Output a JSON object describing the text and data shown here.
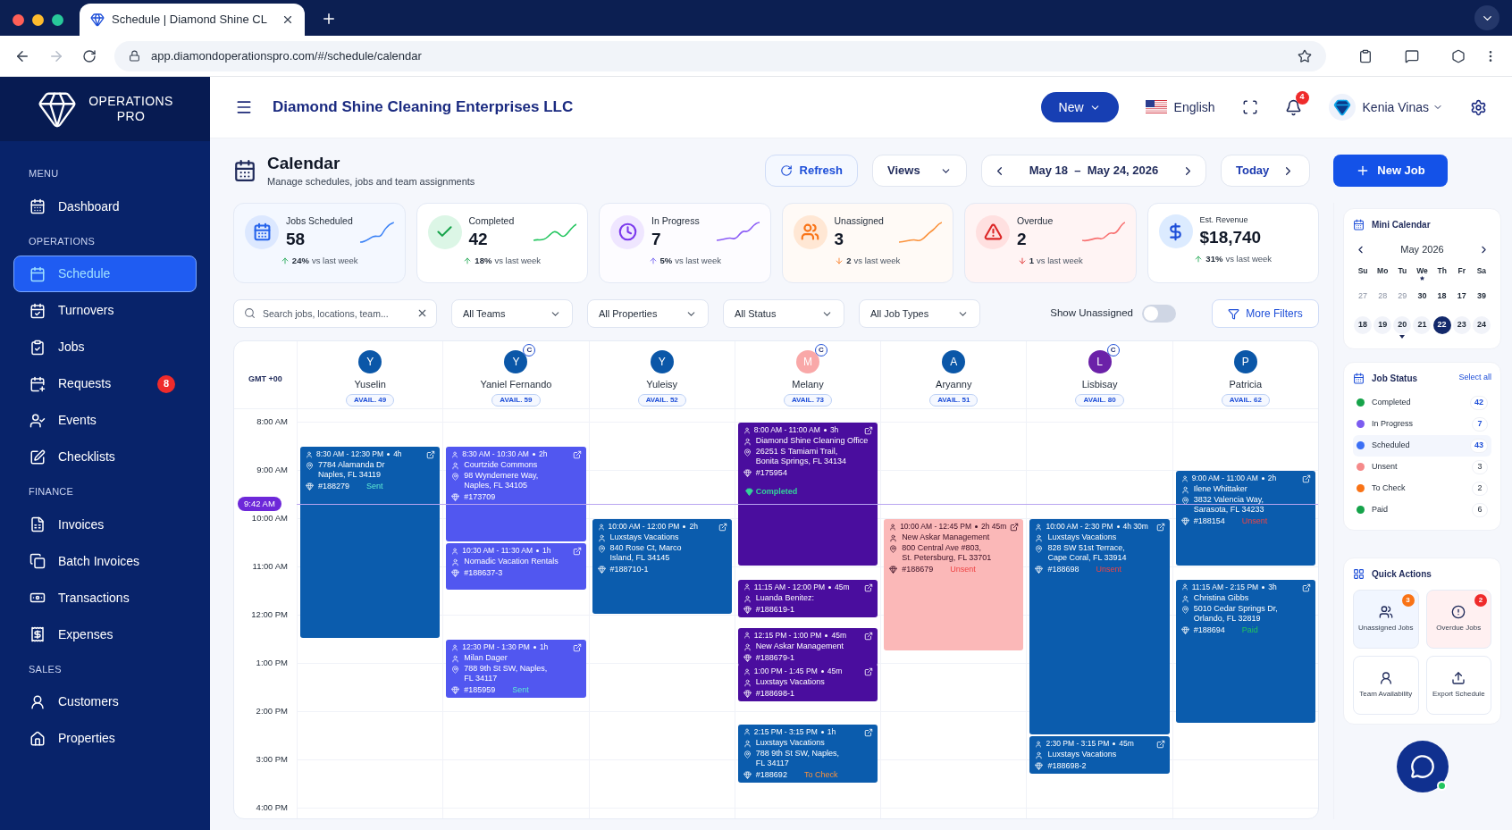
{
  "browser": {
    "tab_title": "Schedule | Diamond Shine CL",
    "url": "app.diamondoperationspro.com/#/schedule/calendar"
  },
  "sidebar": {
    "brand_top": "OPERATIONS",
    "brand_bottom": "PRO",
    "sections": [
      {
        "title": "MENU",
        "items": [
          {
            "label": "Dashboard",
            "selected": false
          }
        ]
      },
      {
        "title": "OPERATIONS",
        "items": [
          {
            "label": "Schedule",
            "selected": true
          },
          {
            "label": "Turnovers",
            "selected": false
          },
          {
            "label": "Jobs",
            "selected": false
          },
          {
            "label": "Requests",
            "selected": false,
            "badge": "8"
          },
          {
            "label": "Events",
            "selected": false
          },
          {
            "label": "Checklists",
            "selected": false
          }
        ]
      },
      {
        "title": "FINANCE",
        "items": [
          {
            "label": "Invoices",
            "selected": false
          },
          {
            "label": "Batch Invoices",
            "selected": false
          },
          {
            "label": "Transactions",
            "selected": false
          },
          {
            "label": "Expenses",
            "selected": false
          }
        ]
      },
      {
        "title": "SALES",
        "items": [
          {
            "label": "Customers",
            "selected": false
          },
          {
            "label": "Properties",
            "selected": false
          }
        ]
      }
    ]
  },
  "header": {
    "company": "Diamond Shine Cleaning Enterprises LLC",
    "new_button": "New",
    "language": "English",
    "notifications": "4",
    "user": "Kenia Vinas"
  },
  "page": {
    "title": "Calendar",
    "subtitle": "Manage schedules, jobs and team assignments",
    "refresh": "Refresh",
    "views": "Views",
    "date_range": "May 18  –  May 24, 2026",
    "today": "Today",
    "new_job": "New Job"
  },
  "stats": [
    {
      "kind": "scheduled",
      "label": "Jobs Scheduled",
      "value": "58",
      "rising": true,
      "change": "24%",
      "note": "vs last week"
    },
    {
      "kind": "completed",
      "label": "Completed",
      "value": "42",
      "rising": true,
      "change": "18%",
      "note": "vs last week"
    },
    {
      "kind": "progress",
      "label": "In Progress",
      "value": "7",
      "rising": true,
      "change": "5%",
      "note": "vs last week"
    },
    {
      "kind": "unassigned",
      "label": "Unassigned",
      "value": "3",
      "rising": false,
      "change": "2",
      "note": "vs last week"
    },
    {
      "kind": "overdue",
      "label": "Overdue",
      "value": "2",
      "rising": false,
      "change": "1",
      "note": "vs last week"
    },
    {
      "kind": "revenue",
      "label": "Est. Revenue",
      "value": "$18,740",
      "rising": true,
      "change": "31%",
      "note": "vs last week"
    }
  ],
  "filters": {
    "search_placeholder": "Search jobs, locations, team...",
    "dropdowns": [
      "All Teams",
      "All Properties",
      "All Status",
      "All Job Types"
    ],
    "show_unassigned": {
      "label": "Show Unassigned",
      "on": false
    },
    "more_filters": "More Filters"
  },
  "calendar": {
    "timezone": "GMT +00",
    "now": "9:42 AM",
    "hours": [
      "8:00 AM",
      "9:00 AM",
      "10:00 AM",
      "11:00 AM",
      "12:00 PM",
      "1:00 PM",
      "2:00 PM",
      "3:00 PM",
      "4:00 PM"
    ],
    "staff": [
      {
        "initial": "Y",
        "name": "Yuselin",
        "avail": "AVAIL. 49",
        "color": "#0b57a8",
        "events": [
          {
            "time": "8:30 AM - 12:30 PM",
            "duration": "4h",
            "address": [
              "7784 Alamanda Dr",
              "Naples, FL 34119"
            ],
            "job": "#188279",
            "status": {
              "text": "Sent",
              "kind": "sent"
            },
            "color": "#0b5cad"
          }
        ]
      },
      {
        "initial": "Y",
        "name": "Yaniel Fernando",
        "avail": "AVAIL. 59",
        "color": "#0b57a8",
        "badge": "C",
        "events": [
          {
            "time": "8:30 AM - 10:30 AM",
            "duration": "2h",
            "client": "Courtzide Commons",
            "address": [
              "98 Wyndemere Way,",
              "Naples, FL 34105"
            ],
            "job": "#173709",
            "color": "#5157f0"
          },
          {
            "time": "10:30 AM - 11:30 AM",
            "duration": "1h",
            "client": "Nomadic Vacation Rentals",
            "job": "#188637-3",
            "color": "#5157f0"
          },
          {
            "time": "12:30 PM - 1:30 PM",
            "duration": "1h",
            "client": "Milan Dager",
            "address": [
              "788 9th St SW, Naples,",
              "FL 34117"
            ],
            "job": "#185959",
            "status": {
              "text": "Sent",
              "kind": "sent"
            },
            "color": "#5157f0"
          }
        ]
      },
      {
        "initial": "Y",
        "name": "Yuleisy",
        "avail": "AVAIL. 52",
        "color": "#0b57a8",
        "events": [
          {
            "time": "10:00 AM - 12:00 PM",
            "duration": "2h",
            "client": "Luxstays Vacations",
            "address": [
              "840 Rose Ct, Marco",
              "Island, FL 34145"
            ],
            "job": "#188710-1",
            "color": "#0b5cad"
          }
        ]
      },
      {
        "initial": "M",
        "name": "Melany",
        "avail": "AVAIL. 73",
        "color": "#f9a8a8",
        "badge": "C",
        "events": [
          {
            "time": "8:00 AM - 11:00 AM",
            "duration": "3h",
            "client": "Diamond Shine Cleaning Office",
            "address": [
              "26251 S Tamiami Trail,",
              "Bonita Springs, FL 34134"
            ],
            "job": "#175954",
            "status": {
              "text": "Completed",
              "kind": "completed"
            },
            "color": "#4a0d9e"
          },
          {
            "time": "11:15 AM - 12:00 PM",
            "duration": "45m",
            "client": "Luanda Benitez:",
            "job": "#188619-1",
            "color": "#4a0d9e"
          },
          {
            "time": "12:15 PM - 1:00 PM",
            "duration": "45m",
            "client": "New Askar Management",
            "job": "#188679-1",
            "color": "#4a0d9e"
          },
          {
            "time": "1:00 PM - 1:45 PM",
            "duration": "45m",
            "client": "Luxstays Vacations",
            "job": "#188698-1",
            "color": "#4a0d9e"
          },
          {
            "time": "2:15 PM - 3:15 PM",
            "duration": "1h",
            "client": "Luxstays Vacations",
            "address": [
              "788 9th St SW, Naples,",
              "FL 34117"
            ],
            "job": "#188692",
            "status": {
              "text": "To Check",
              "kind": "to_check"
            },
            "color": "#0b5cad"
          }
        ]
      },
      {
        "initial": "A",
        "name": "Aryanny",
        "avail": "AVAIL. 51",
        "color": "#0b57a8",
        "events": [
          {
            "time": "10:00 AM - 12:45 PM",
            "duration": "2h 45m",
            "client": "New Askar Management",
            "address": [
              "800 Central Ave #803,",
              "St. Petersburg, FL 33701"
            ],
            "job": "#188679",
            "status": {
              "text": "Unsent",
              "kind": "unsent"
            },
            "color": "#fbb8b8"
          }
        ]
      },
      {
        "initial": "L",
        "name": "Lisbisay",
        "avail": "AVAIL. 80",
        "color": "#6b21a8",
        "badge": "C",
        "events": [
          {
            "time": "10:00 AM - 2:30 PM",
            "duration": "4h 30m",
            "client": "Luxstays Vacations",
            "address": [
              "828 SW 51st Terrace,",
              "Cape Coral, FL 33914"
            ],
            "job": "#188698",
            "status": {
              "text": "Unsent",
              "kind": "unsent"
            },
            "color": "#0b5cad"
          },
          {
            "time": "2:30 PM - 3:15 PM",
            "duration": "45m",
            "client": "Luxstays Vacations",
            "job": "#188698-2",
            "color": "#0b5cad"
          }
        ]
      },
      {
        "initial": "P",
        "name": "Patricia",
        "avail": "AVAIL. 62",
        "color": "#0b57a8",
        "events": [
          {
            "time": "9:00 AM - 11:00 AM",
            "duration": "2h",
            "client": "Ilene Whittaker",
            "address": [
              "3832 Valencia Way,",
              "Sarasota, FL 34233"
            ],
            "job": "#188154",
            "status": {
              "text": "Unsent",
              "kind": "unsent"
            },
            "color": "#0b5cad"
          },
          {
            "time": "11:15 AM - 2:15 PM",
            "duration": "3h",
            "client": "Christina Gibbs",
            "address": [
              "5010 Cedar Springs Dr,",
              "Orlando, FL 32819"
            ],
            "job": "#188694",
            "status": {
              "text": "Paid",
              "kind": "paid"
            },
            "color": "#0b5cad"
          }
        ]
      }
    ]
  },
  "mini_calendar": {
    "title": "Mini Calendar",
    "month": "May 2026",
    "weekdays": [
      {
        "label": "Su",
        "marked": false
      },
      {
        "label": "Mo",
        "marked": false
      },
      {
        "label": "Tu",
        "marked": false
      },
      {
        "label": "We",
        "marked": true
      },
      {
        "label": "Th",
        "marked": false
      },
      {
        "label": "Fr",
        "marked": false
      },
      {
        "label": "Sa",
        "marked": false
      }
    ],
    "weeks": [
      [
        {
          "day": "27",
          "muted": true,
          "selected": false,
          "marked": false
        },
        {
          "day": "28",
          "muted": true,
          "selected": false,
          "marked": false
        },
        {
          "day": "29",
          "muted": true,
          "selected": false,
          "marked": false
        },
        {
          "day": "30",
          "muted": false,
          "selected": false,
          "marked": false
        },
        {
          "day": "18",
          "muted": false,
          "selected": false,
          "marked": false
        },
        {
          "day": "17",
          "muted": false,
          "selected": false,
          "marked": false
        },
        {
          "day": "39",
          "muted": false,
          "selected": false,
          "marked": false
        }
      ],
      [
        {
          "day": "18",
          "muted": false,
          "selected": false,
          "marked": false
        },
        {
          "day": "19",
          "muted": false,
          "selected": false,
          "marked": false
        },
        {
          "day": "20",
          "muted": false,
          "selected": false,
          "marked": true
        },
        {
          "day": "21",
          "muted": false,
          "selected": false,
          "marked": false
        },
        {
          "day": "22",
          "muted": false,
          "selected": true,
          "marked": false
        },
        {
          "day": "23",
          "muted": false,
          "selected": false,
          "marked": false
        },
        {
          "day": "24",
          "muted": false,
          "selected": false,
          "marked": false
        }
      ]
    ]
  },
  "job_status": {
    "title": "Job Status",
    "select_all": "Select all",
    "items": [
      {
        "label": "Completed",
        "color": "#16a34a",
        "count": "42",
        "active": true,
        "selected": false
      },
      {
        "label": "In Progress",
        "color": "#7c5cf0",
        "count": "7",
        "active": true,
        "selected": false
      },
      {
        "label": "Scheduled",
        "color": "#3b6ff5",
        "count": "43",
        "active": true,
        "selected": true
      },
      {
        "label": "Unsent",
        "color": "#f58a8a",
        "count": "3",
        "active": false,
        "selected": false
      },
      {
        "label": "To Check",
        "color": "#f97316",
        "count": "2",
        "active": false,
        "selected": false
      },
      {
        "label": "Paid",
        "color": "#15a34a",
        "count": "6",
        "active": false,
        "selected": false
      }
    ]
  },
  "quick_actions": {
    "title": "Quick Actions",
    "items": [
      {
        "kind": "unassigned",
        "label": "Unassigned Jobs",
        "badge": "3"
      },
      {
        "kind": "overdue",
        "label": "Overdue Jobs",
        "badge": "2"
      },
      {
        "kind": "team",
        "label": "Team Availability"
      },
      {
        "kind": "export",
        "label": "Export Schedule"
      }
    ]
  }
}
